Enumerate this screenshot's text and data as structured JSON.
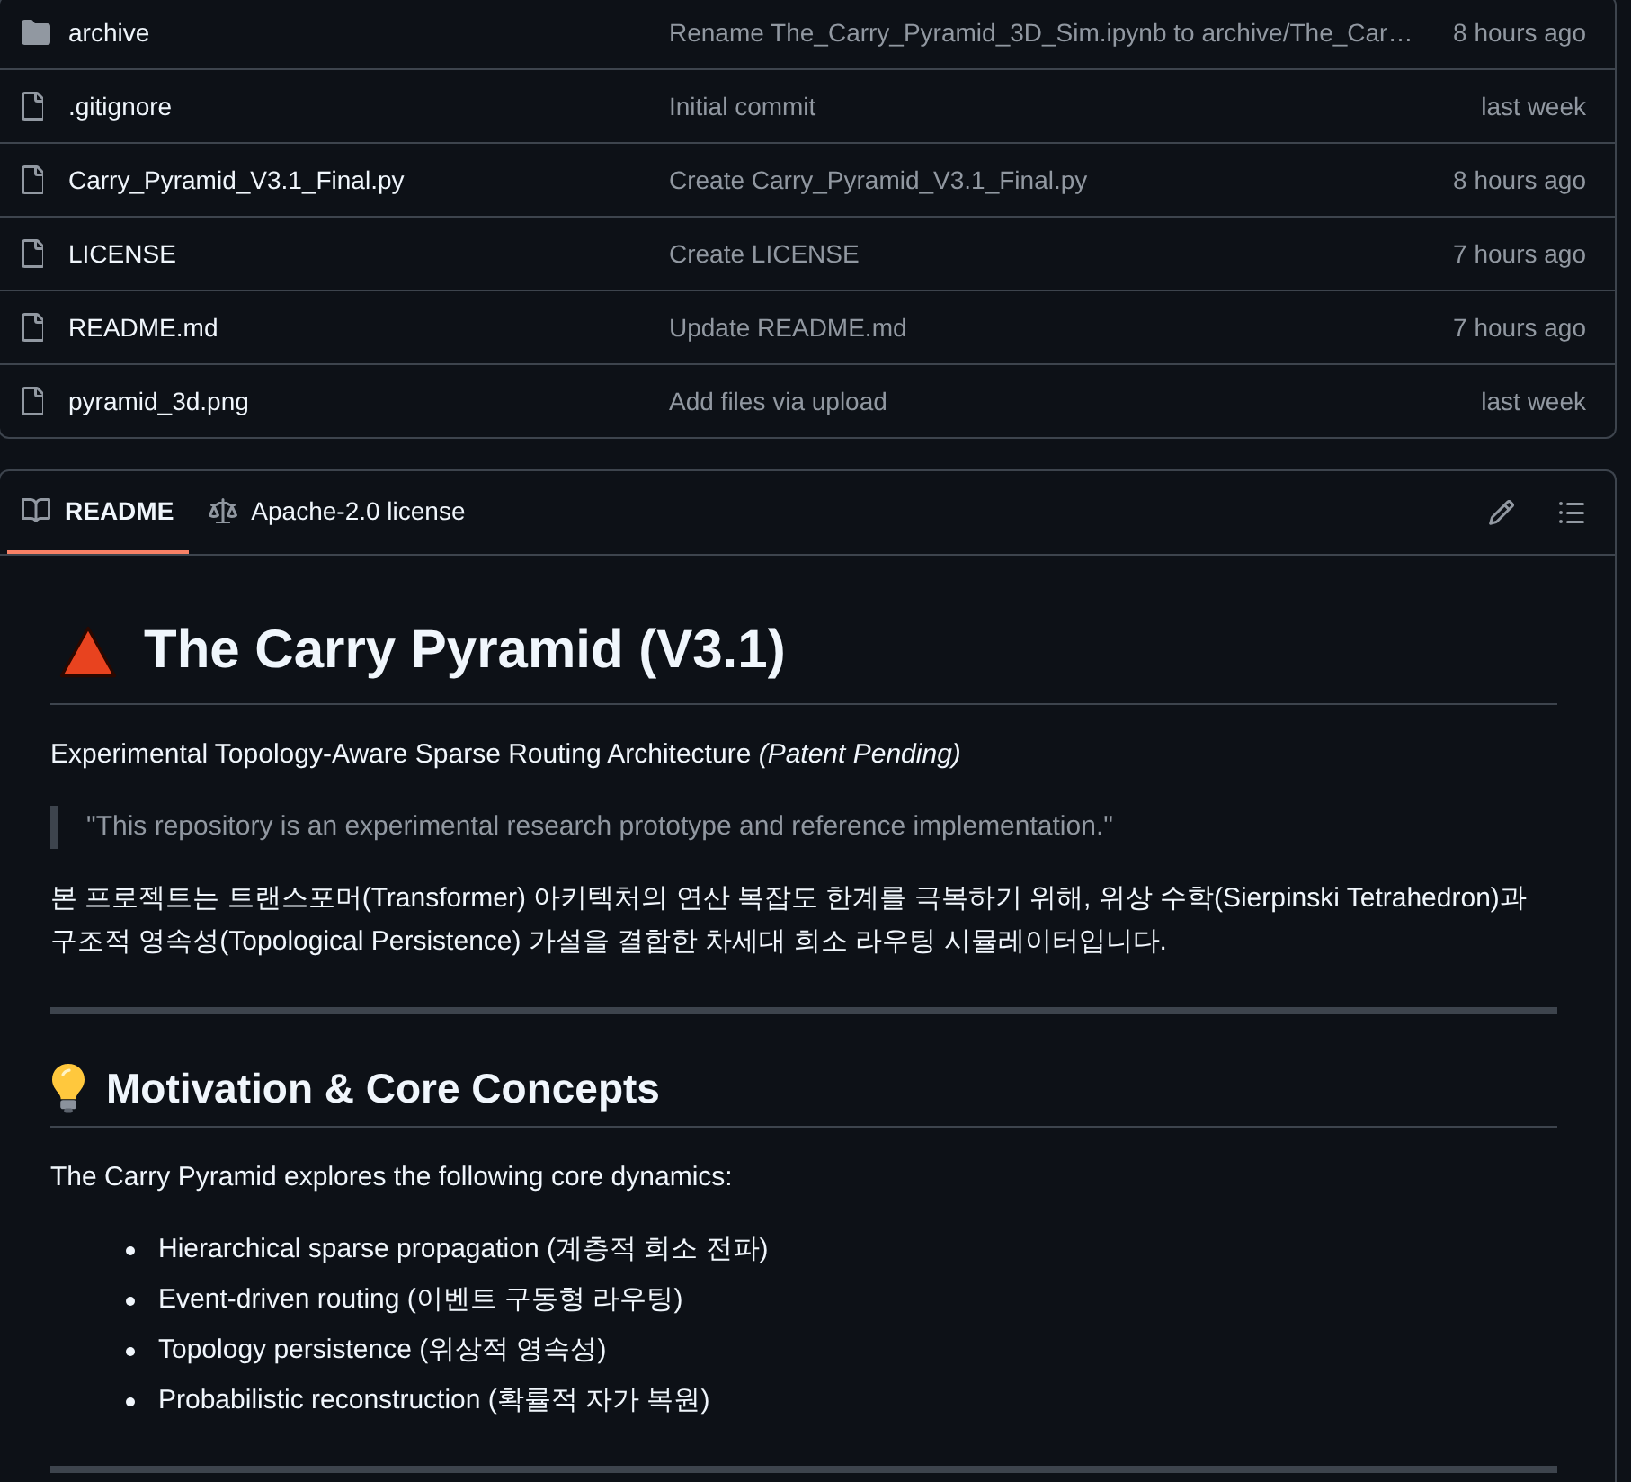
{
  "files": [
    {
      "kind": "folder",
      "name": "archive",
      "message": "Rename The_Carry_Pyramid_3D_Sim.ipynb to archive/The_Car…",
      "time": "8 hours ago"
    },
    {
      "kind": "file",
      "name": ".gitignore",
      "message": "Initial commit",
      "time": "last week"
    },
    {
      "kind": "file",
      "name": "Carry_Pyramid_V3.1_Final.py",
      "message": "Create Carry_Pyramid_V3.1_Final.py",
      "time": "8 hours ago"
    },
    {
      "kind": "file",
      "name": "LICENSE",
      "message": "Create LICENSE",
      "time": "7 hours ago"
    },
    {
      "kind": "file",
      "name": "README.md",
      "message": "Update README.md",
      "time": "7 hours ago"
    },
    {
      "kind": "file",
      "name": "pyramid_3d.png",
      "message": "Add files via upload",
      "time": "last week"
    }
  ],
  "readme": {
    "tabs": [
      {
        "kind": "readme",
        "label": "README",
        "selected": true
      },
      {
        "kind": "license",
        "label": "Apache-2.0 license",
        "selected": false
      }
    ],
    "title": "The Carry Pyramid (V3.1)",
    "subtitle": "Experimental Topology-Aware Sparse Routing Architecture *(Patent Pending)*",
    "quote": "\"This repository is an experimental research prototype and reference implementation.\"",
    "intro": "본 프로젝트는 트랜스포머(Transformer) 아키텍처의 연산 복잡도 한계를 극복하기 위해, 위상 수학(Sierpinski Tetrahedron)과 구조적 영속성(Topological Persistence) 가설을 결합한 차세대 희소 라우팅 시뮬레이터입니다.",
    "sections": [
      {
        "heading": "Motivation & Core Concepts",
        "lead": "The Carry Pyramid explores the following core dynamics:",
        "items": [
          "Hierarchical sparse propagation (계층적 희소 전파)",
          "Event-driven routing (이벤트 구동형 라우팅)",
          "Topology persistence (위상적 영속성)",
          "Probabilistic reconstruction (확률적 자가 복원)"
        ]
      }
    ]
  }
}
